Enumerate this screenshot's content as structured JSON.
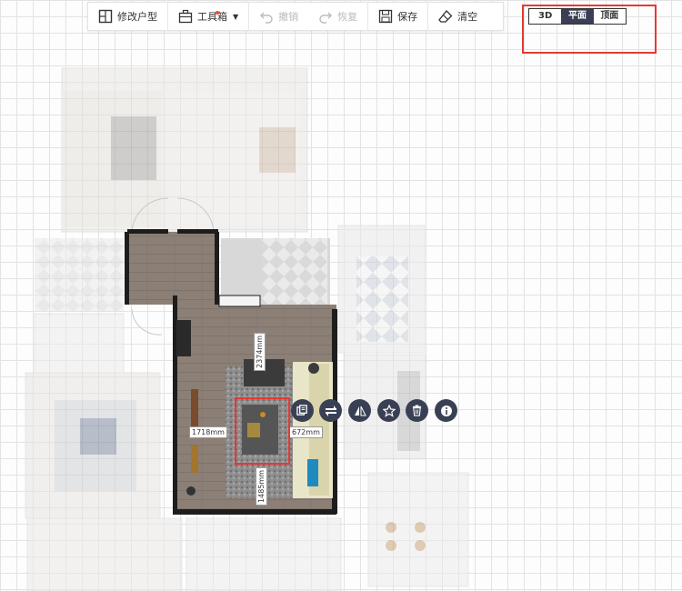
{
  "toolbar": {
    "edit_layout": "修改户型",
    "toolbox": "工具箱",
    "undo": "撤销",
    "redo": "恢复",
    "save": "保存",
    "clear": "清空"
  },
  "view_switch": {
    "options": [
      "3D",
      "平面",
      "顶面"
    ],
    "active": "平面"
  },
  "dimensions": {
    "top": "2374mm",
    "left": "1718mm",
    "right": "672mm",
    "bottom": "1485mm"
  },
  "context_menu": {
    "icons": [
      "copy-icon",
      "flip-horizontal-icon",
      "mirror-icon",
      "favorite-star-icon",
      "delete-trash-icon",
      "info-icon"
    ]
  },
  "colors": {
    "accent_dark": "#3a3f55",
    "highlight_red": "#e53935",
    "floor_wood": "#8a7c72"
  }
}
